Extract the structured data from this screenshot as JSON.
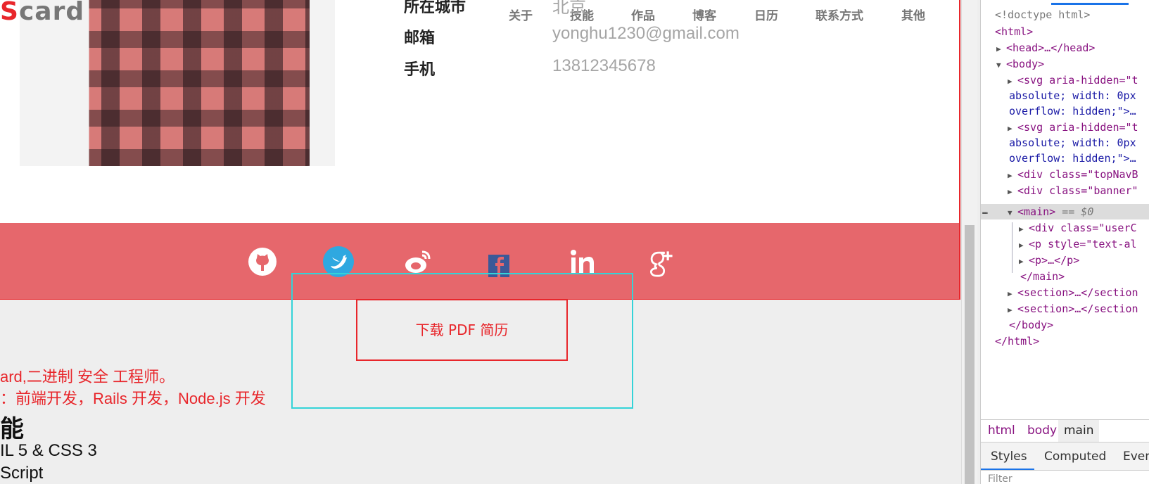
{
  "logo": {
    "accent": "S",
    "text": "card"
  },
  "nav": [
    "关于",
    "技能",
    "作品",
    "博客",
    "日历",
    "联系方式",
    "其他"
  ],
  "info": [
    {
      "label": "所在城市",
      "value": "北京"
    },
    {
      "label": "邮箱",
      "value": "yonghu1230@gmail.com"
    },
    {
      "label": "手机",
      "value": "13812345678"
    }
  ],
  "social_icons": [
    "github-icon",
    "twitter-icon",
    "weibo-icon",
    "facebook-icon",
    "linkedin-icon",
    "google-plus-icon"
  ],
  "download_label": "下载 PDF 简历",
  "description": [
    "ard,二进制 安全 工程师。",
    "：前端开发，Rails 开发，Node.js 开发"
  ],
  "skills_heading": "能",
  "skills": [
    "IL 5 & CSS 3",
    "Script"
  ],
  "colors": {
    "accent": "#e8262b",
    "social_bar": "#e6676c",
    "highlight": "#34d3d8",
    "page_bg": "#eeeeee"
  },
  "devtools": {
    "doctype": "<!doctype html>",
    "html_open": "<html>",
    "head": "<head>…</head>",
    "body_open": "<body>",
    "svg1_a": "<svg aria-hidden=\"t",
    "svg1_b": "absolute; width: 0px",
    "svg1_c": "overflow: hidden;\">…",
    "svg2_a": "<svg aria-hidden=\"t",
    "svg2_b": "absolute; width: 0px",
    "svg2_c": "overflow: hidden;\">…",
    "div_topnav": "<div class=\"topNavB",
    "div_banner": "<div class=\"banner\"",
    "main_open": "<main>",
    "main_eq": " == $0",
    "div_user": "<div class=\"userC",
    "p_style": "<p style=\"text-al",
    "p_close": "<p>…</p>",
    "main_close": "</main>",
    "section1": "<section>…</section",
    "section2": "<section>…</section",
    "body_close": "</body>",
    "html_close": "</html>",
    "dots": "…",
    "breadcrumbs": [
      "html",
      "body",
      "main"
    ],
    "tabs": [
      "Styles",
      "Computed",
      "Even"
    ],
    "filter_placeholder": "Filter"
  }
}
